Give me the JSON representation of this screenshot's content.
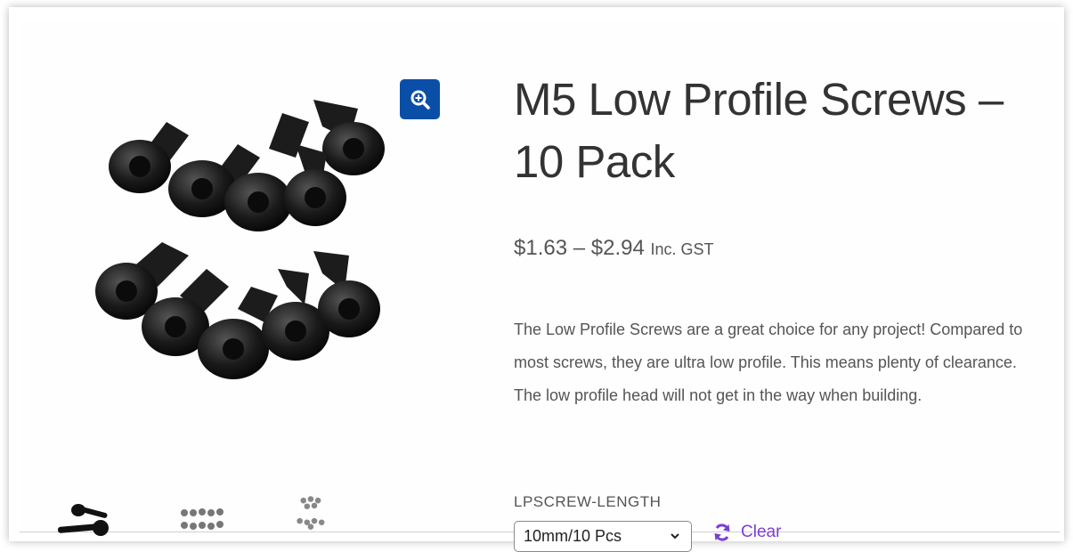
{
  "product": {
    "title": "M5 Low Profile Screws – 10 Pack",
    "price_range": "$1.63 – $2.94",
    "price_suffix": "Inc. GST",
    "description": "The Low Profile Screws are a great choice for any project!  Compared to most screws, they are ultra low profile.  This means plenty of clearance.  The low profile head will not get in the way when building."
  },
  "gallery": {
    "zoom_icon": "zoom-in-icon",
    "thumbnails": [
      "thumbnail-1",
      "thumbnail-2",
      "thumbnail-3"
    ]
  },
  "variation": {
    "label": "LPSCREW-LENGTH",
    "selected": "10mm/10 Pcs",
    "clear_label": "Clear",
    "clear_icon": "refresh-icon"
  },
  "colors": {
    "zoom_button": "#0a4ea7",
    "clear_link": "#7b3fd0",
    "text": "#555555",
    "title": "#333333"
  }
}
